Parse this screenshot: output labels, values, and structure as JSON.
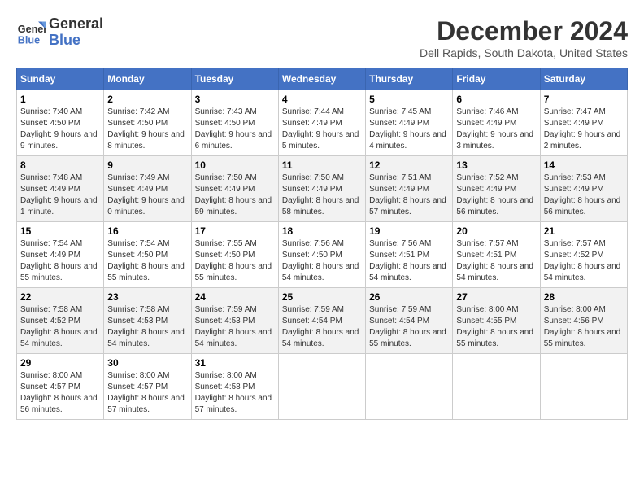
{
  "logo": {
    "line1": "General",
    "line2": "Blue"
  },
  "title": "December 2024",
  "subtitle": "Dell Rapids, South Dakota, United States",
  "days_header": [
    "Sunday",
    "Monday",
    "Tuesday",
    "Wednesday",
    "Thursday",
    "Friday",
    "Saturday"
  ],
  "weeks": [
    [
      {
        "day": "1",
        "sunrise": "7:40 AM",
        "sunset": "4:50 PM",
        "daylight": "9 hours and 9 minutes."
      },
      {
        "day": "2",
        "sunrise": "7:42 AM",
        "sunset": "4:50 PM",
        "daylight": "9 hours and 8 minutes."
      },
      {
        "day": "3",
        "sunrise": "7:43 AM",
        "sunset": "4:50 PM",
        "daylight": "9 hours and 6 minutes."
      },
      {
        "day": "4",
        "sunrise": "7:44 AM",
        "sunset": "4:49 PM",
        "daylight": "9 hours and 5 minutes."
      },
      {
        "day": "5",
        "sunrise": "7:45 AM",
        "sunset": "4:49 PM",
        "daylight": "9 hours and 4 minutes."
      },
      {
        "day": "6",
        "sunrise": "7:46 AM",
        "sunset": "4:49 PM",
        "daylight": "9 hours and 3 minutes."
      },
      {
        "day": "7",
        "sunrise": "7:47 AM",
        "sunset": "4:49 PM",
        "daylight": "9 hours and 2 minutes."
      }
    ],
    [
      {
        "day": "8",
        "sunrise": "7:48 AM",
        "sunset": "4:49 PM",
        "daylight": "9 hours and 1 minute."
      },
      {
        "day": "9",
        "sunrise": "7:49 AM",
        "sunset": "4:49 PM",
        "daylight": "9 hours and 0 minutes."
      },
      {
        "day": "10",
        "sunrise": "7:50 AM",
        "sunset": "4:49 PM",
        "daylight": "8 hours and 59 minutes."
      },
      {
        "day": "11",
        "sunrise": "7:50 AM",
        "sunset": "4:49 PM",
        "daylight": "8 hours and 58 minutes."
      },
      {
        "day": "12",
        "sunrise": "7:51 AM",
        "sunset": "4:49 PM",
        "daylight": "8 hours and 57 minutes."
      },
      {
        "day": "13",
        "sunrise": "7:52 AM",
        "sunset": "4:49 PM",
        "daylight": "8 hours and 56 minutes."
      },
      {
        "day": "14",
        "sunrise": "7:53 AM",
        "sunset": "4:49 PM",
        "daylight": "8 hours and 56 minutes."
      }
    ],
    [
      {
        "day": "15",
        "sunrise": "7:54 AM",
        "sunset": "4:49 PM",
        "daylight": "8 hours and 55 minutes."
      },
      {
        "day": "16",
        "sunrise": "7:54 AM",
        "sunset": "4:50 PM",
        "daylight": "8 hours and 55 minutes."
      },
      {
        "day": "17",
        "sunrise": "7:55 AM",
        "sunset": "4:50 PM",
        "daylight": "8 hours and 55 minutes."
      },
      {
        "day": "18",
        "sunrise": "7:56 AM",
        "sunset": "4:50 PM",
        "daylight": "8 hours and 54 minutes."
      },
      {
        "day": "19",
        "sunrise": "7:56 AM",
        "sunset": "4:51 PM",
        "daylight": "8 hours and 54 minutes."
      },
      {
        "day": "20",
        "sunrise": "7:57 AM",
        "sunset": "4:51 PM",
        "daylight": "8 hours and 54 minutes."
      },
      {
        "day": "21",
        "sunrise": "7:57 AM",
        "sunset": "4:52 PM",
        "daylight": "8 hours and 54 minutes."
      }
    ],
    [
      {
        "day": "22",
        "sunrise": "7:58 AM",
        "sunset": "4:52 PM",
        "daylight": "8 hours and 54 minutes."
      },
      {
        "day": "23",
        "sunrise": "7:58 AM",
        "sunset": "4:53 PM",
        "daylight": "8 hours and 54 minutes."
      },
      {
        "day": "24",
        "sunrise": "7:59 AM",
        "sunset": "4:53 PM",
        "daylight": "8 hours and 54 minutes."
      },
      {
        "day": "25",
        "sunrise": "7:59 AM",
        "sunset": "4:54 PM",
        "daylight": "8 hours and 54 minutes."
      },
      {
        "day": "26",
        "sunrise": "7:59 AM",
        "sunset": "4:54 PM",
        "daylight": "8 hours and 55 minutes."
      },
      {
        "day": "27",
        "sunrise": "8:00 AM",
        "sunset": "4:55 PM",
        "daylight": "8 hours and 55 minutes."
      },
      {
        "day": "28",
        "sunrise": "8:00 AM",
        "sunset": "4:56 PM",
        "daylight": "8 hours and 55 minutes."
      }
    ],
    [
      {
        "day": "29",
        "sunrise": "8:00 AM",
        "sunset": "4:57 PM",
        "daylight": "8 hours and 56 minutes."
      },
      {
        "day": "30",
        "sunrise": "8:00 AM",
        "sunset": "4:57 PM",
        "daylight": "8 hours and 57 minutes."
      },
      {
        "day": "31",
        "sunrise": "8:00 AM",
        "sunset": "4:58 PM",
        "daylight": "8 hours and 57 minutes."
      },
      null,
      null,
      null,
      null
    ]
  ]
}
